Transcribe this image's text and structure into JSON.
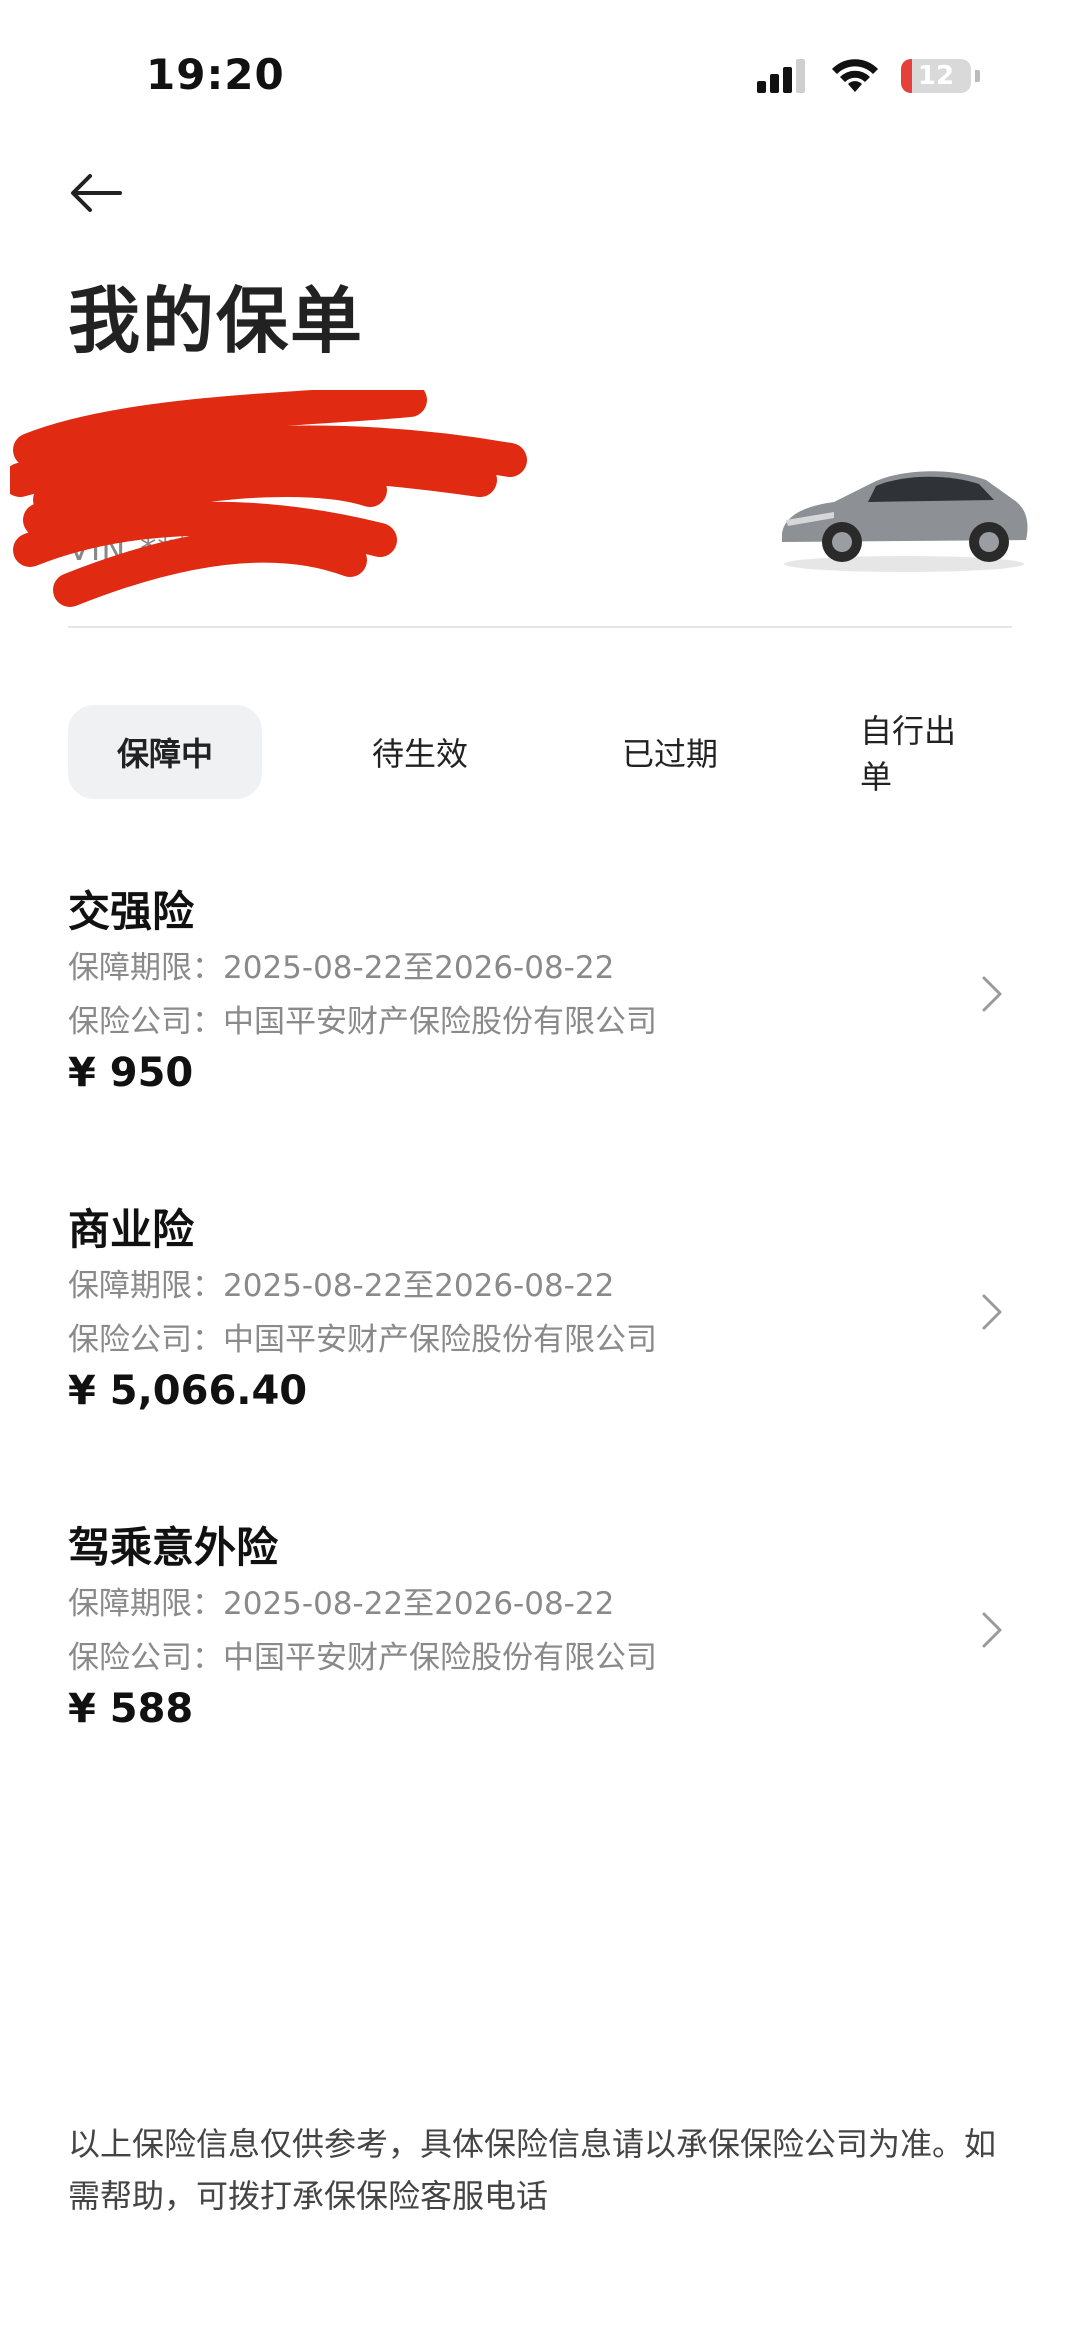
{
  "status_bar": {
    "time": "19:20",
    "battery": "12"
  },
  "header": {
    "title": "我的保单"
  },
  "car": {
    "plate": "",
    "vin_label": "VIN",
    "vin_masked": "*******2591",
    "image": "car-photo"
  },
  "tabs": [
    {
      "label": "保障中",
      "active": true
    },
    {
      "label": "待生效",
      "active": false
    },
    {
      "label": "已过期",
      "active": false
    },
    {
      "label": "自行出单",
      "active": false
    }
  ],
  "policies": [
    {
      "name": "交强险",
      "period": "保障期限：2025-08-22至2026-08-22",
      "company": "保险公司：中国平安财产保险股份有限公司",
      "price": "¥ 950"
    },
    {
      "name": "商业险",
      "period": "保障期限：2025-08-22至2026-08-22",
      "company": "保险公司：中国平安财产保险股份有限公司",
      "price": "¥ 5,066.40"
    },
    {
      "name": "驾乘意外险",
      "period": "保障期限：2025-08-22至2026-08-22",
      "company": "保险公司：中国平安财产保险股份有限公司",
      "price": "¥ 588"
    }
  ],
  "footer": {
    "note": "以上保险信息仅供参考，具体保险信息请以承保保险公司为准。如需帮助，可拨打承保保险客服电话"
  },
  "colors": {
    "redaction": "#e02a12",
    "tab_active_bg": "#f0f1f3"
  }
}
